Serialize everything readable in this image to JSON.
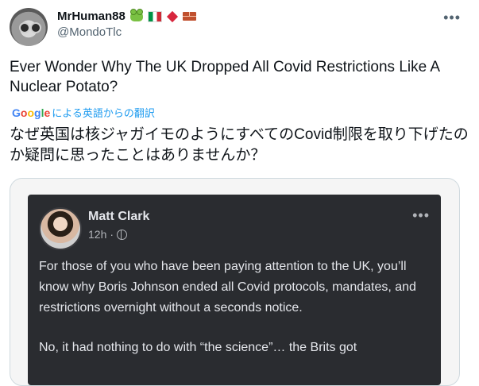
{
  "tweet": {
    "display_name": "MrHuman88",
    "handle": "@MondoTlc",
    "badges": [
      "frog-emoji",
      "italy-flag-emoji",
      "diamond-emoji",
      "brick-emoji"
    ],
    "text": "Ever Wonder Why The UK Dropped All Covid Restrictions Like A Nuclear Potato?",
    "translate_label": "による英語からの翻訳",
    "translated_text": "なぜ英国は核ジャガイモのようにすべてのCovid制限を取り下げたのか疑問に思ったことはありませんか？"
  },
  "embedded_post": {
    "author": "Matt Clark",
    "time": "12h",
    "separator": "·",
    "paragraph1": "For those of you who have been paying attention to the UK, you’ll know why Boris Johnson ended all Covid protocols, mandates, and restrictions overnight without a seconds notice.",
    "paragraph2": "No, it had nothing to do with “the science”… the Brits got"
  },
  "colors": {
    "link_blue": "#1d9bf0",
    "secondary_text": "#536471",
    "fb_background": "#2a2c30"
  }
}
